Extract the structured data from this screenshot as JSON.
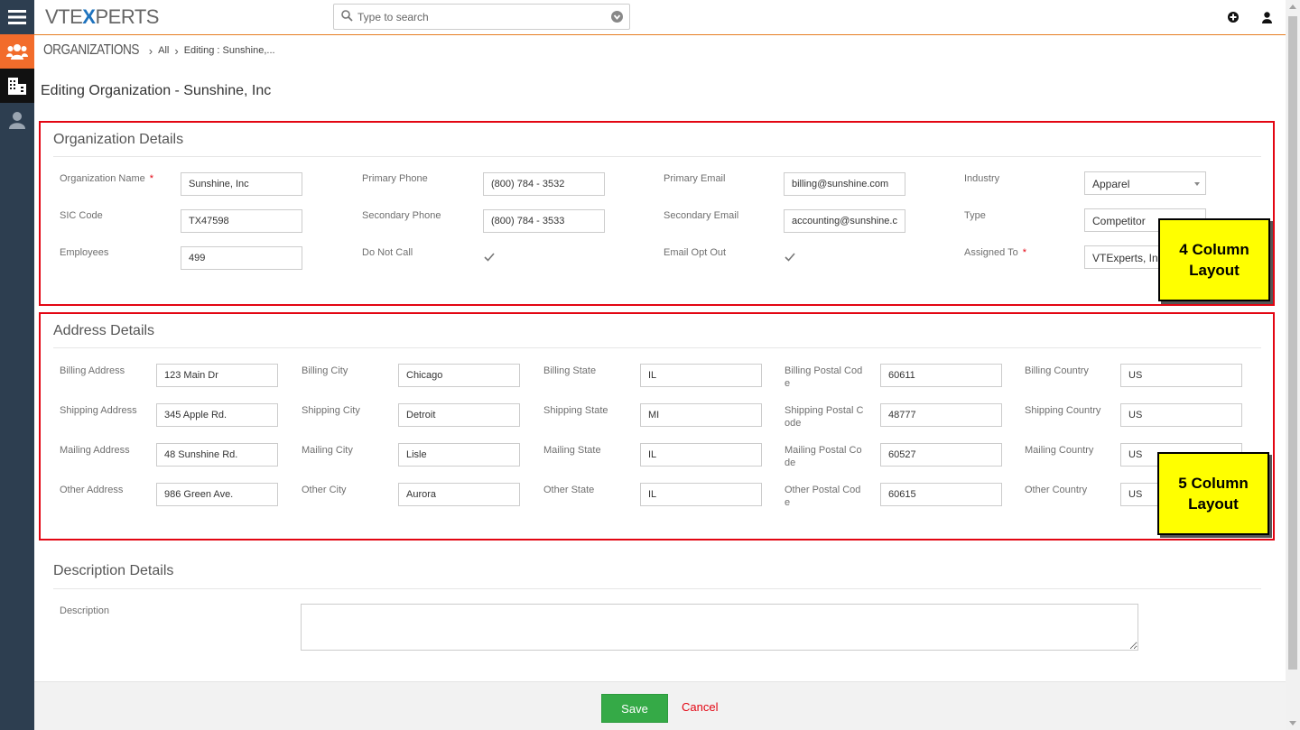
{
  "app": {
    "logo_prefix": "VTE",
    "logo_x": "X",
    "logo_suffix": "PERTS"
  },
  "search": {
    "placeholder": "Type to search"
  },
  "breadcrumb": {
    "module": "ORGANIZATIONS",
    "filter": "All",
    "current": "Editing : Sunshine,..."
  },
  "page_title": "Editing Organization - Sunshine, Inc",
  "organization_details": {
    "title": "Organization Details",
    "fields": {
      "organization_name": {
        "label": "Organization Name",
        "value": "Sunshine, Inc",
        "required": "*"
      },
      "primary_phone": {
        "label": "Primary Phone",
        "value": "(800) 784 - 3532"
      },
      "primary_email": {
        "label": "Primary Email",
        "value": "billing@sunshine.com"
      },
      "industry": {
        "label": "Industry",
        "value": "Apparel"
      },
      "sic_code": {
        "label": "SIC Code",
        "value": "TX47598"
      },
      "secondary_phone": {
        "label": "Secondary Phone",
        "value": "(800) 784 - 3533"
      },
      "secondary_email": {
        "label": "Secondary Email",
        "value": "accounting@sunshine.c"
      },
      "type": {
        "label": "Type",
        "value": "Competitor"
      },
      "employees": {
        "label": "Employees",
        "value": "499"
      },
      "do_not_call": {
        "label": "Do Not Call",
        "checked": true
      },
      "email_opt_out": {
        "label": "Email Opt Out",
        "checked": true
      },
      "assigned_to": {
        "label": "Assigned To",
        "value": "VTExperts, Inc",
        "required": "*"
      }
    },
    "callout": {
      "line1": "4 Column",
      "line2": "Layout"
    }
  },
  "address_details": {
    "title": "Address Details",
    "rows": [
      {
        "address": {
          "label": "Billing Address",
          "value": "123 Main Dr"
        },
        "city": {
          "label": "Billing City",
          "value": "Chicago"
        },
        "state": {
          "label": "Billing State",
          "value": "IL"
        },
        "postal": {
          "label1": "Billing Postal Cod",
          "label2": "e",
          "value": "60611"
        },
        "country": {
          "label": "Billing Country",
          "value": "US"
        }
      },
      {
        "address": {
          "label": "Shipping Address",
          "value": "345 Apple Rd."
        },
        "city": {
          "label": "Shipping City",
          "value": "Detroit"
        },
        "state": {
          "label": "Shipping State",
          "value": "MI"
        },
        "postal": {
          "label1": "Shipping Postal C",
          "label2": "ode",
          "value": "48777"
        },
        "country": {
          "label": "Shipping Country",
          "value": "US"
        }
      },
      {
        "address": {
          "label": "Mailing Address",
          "value": "48 Sunshine Rd."
        },
        "city": {
          "label": "Mailing City",
          "value": "Lisle"
        },
        "state": {
          "label": "Mailing State",
          "value": "IL"
        },
        "postal": {
          "label1": "Mailing Postal Co",
          "label2": "de",
          "value": "60527"
        },
        "country": {
          "label": "Mailing Country",
          "value": "US"
        }
      },
      {
        "address": {
          "label": "Other Address",
          "value": "986 Green Ave."
        },
        "city": {
          "label": "Other City",
          "value": "Aurora"
        },
        "state": {
          "label": "Other State",
          "value": "IL"
        },
        "postal": {
          "label1": "Other Postal Cod",
          "label2": "e",
          "value": "60615"
        },
        "country": {
          "label": "Other Country",
          "value": "US"
        }
      }
    ],
    "callout": {
      "line1": "5 Column",
      "line2": "Layout"
    }
  },
  "description_details": {
    "title": "Description Details",
    "description": {
      "label": "Description",
      "value": ""
    }
  },
  "footer": {
    "save_label": "Save",
    "cancel_label": "Cancel"
  },
  "colors": {
    "accent": "#f26c2b",
    "rail": "#2d3e50",
    "highlight": "#e30613",
    "save": "#35aa47",
    "callout": "#ffff00"
  },
  "icons": {
    "menu": "hamburger-icon",
    "users": "users-group-icon",
    "org": "organization-building-icon",
    "contact": "contact-person-icon",
    "search": "search-icon",
    "dropdown": "chevron-down-circle-icon",
    "add": "add-circle-icon",
    "user": "user-icon"
  }
}
